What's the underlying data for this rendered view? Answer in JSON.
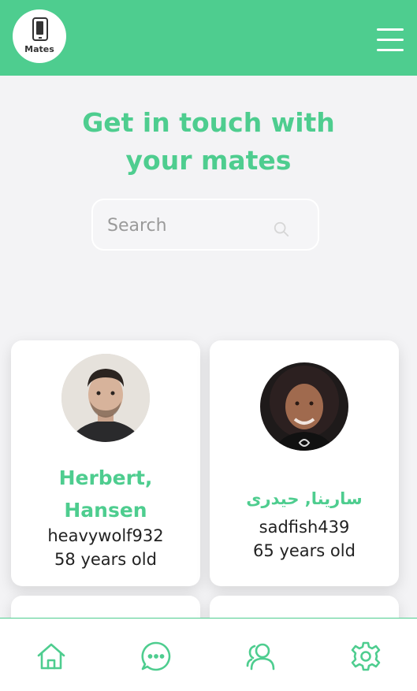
{
  "app": {
    "logo_text": "Mates",
    "accent_color": "#4ecd8f"
  },
  "header": {
    "menu_icon": "hamburger-menu-icon"
  },
  "hero": {
    "title_line1": "Get in touch with",
    "title_line2": "your mates"
  },
  "search": {
    "placeholder": "Search",
    "value": "",
    "icon": "search-icon"
  },
  "mates": [
    {
      "name": "Herbert, Hansen",
      "username": "heavywolf932",
      "age": "58 years old"
    },
    {
      "name": "سارينا, حيدری",
      "username": "sadfish439",
      "age": "65 years old"
    }
  ],
  "bottom_nav": [
    {
      "icon": "home-icon"
    },
    {
      "icon": "chat-icon"
    },
    {
      "icon": "users-icon"
    },
    {
      "icon": "gear-icon"
    }
  ]
}
